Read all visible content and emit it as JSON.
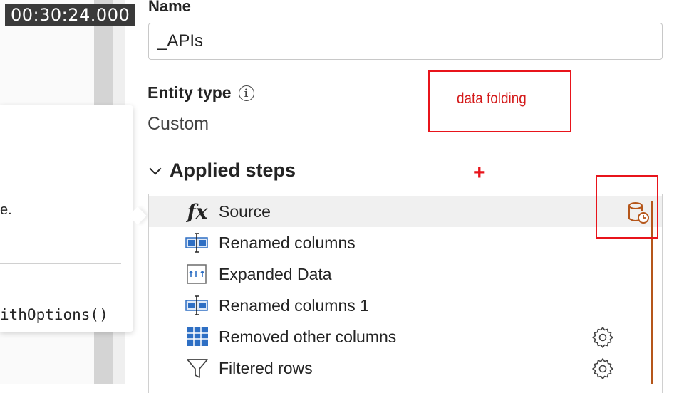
{
  "timestamp": "00:30:24.000",
  "tooltip": {
    "fragment_1": "e.",
    "fragment_2": "ithOptions()"
  },
  "properties": {
    "name_label": "Name",
    "name_value": "_APIs",
    "entity_type_label": "Entity type",
    "entity_type_value": "Custom"
  },
  "annotations": {
    "note_text": "data folding",
    "plus": "+"
  },
  "applied_steps": {
    "header": "Applied steps",
    "items": [
      {
        "label": "Source",
        "icon": "fx-icon",
        "selected": true,
        "has_gear": false,
        "has_db": true
      },
      {
        "label": "Renamed columns",
        "icon": "rename-columns-icon",
        "selected": false,
        "has_gear": false
      },
      {
        "label": "Expanded Data",
        "icon": "expand-icon",
        "selected": false,
        "has_gear": false
      },
      {
        "label": "Renamed columns 1",
        "icon": "rename-columns-icon",
        "selected": false,
        "has_gear": false
      },
      {
        "label": "Removed other columns",
        "icon": "table-icon",
        "selected": false,
        "has_gear": true
      },
      {
        "label": "Filtered rows",
        "icon": "filter-icon",
        "selected": false,
        "has_gear": true
      }
    ]
  },
  "colors": {
    "annotation_red": "#e8141b",
    "folding_line": "#b5561a",
    "icon_blue": "#2e6fc4"
  }
}
